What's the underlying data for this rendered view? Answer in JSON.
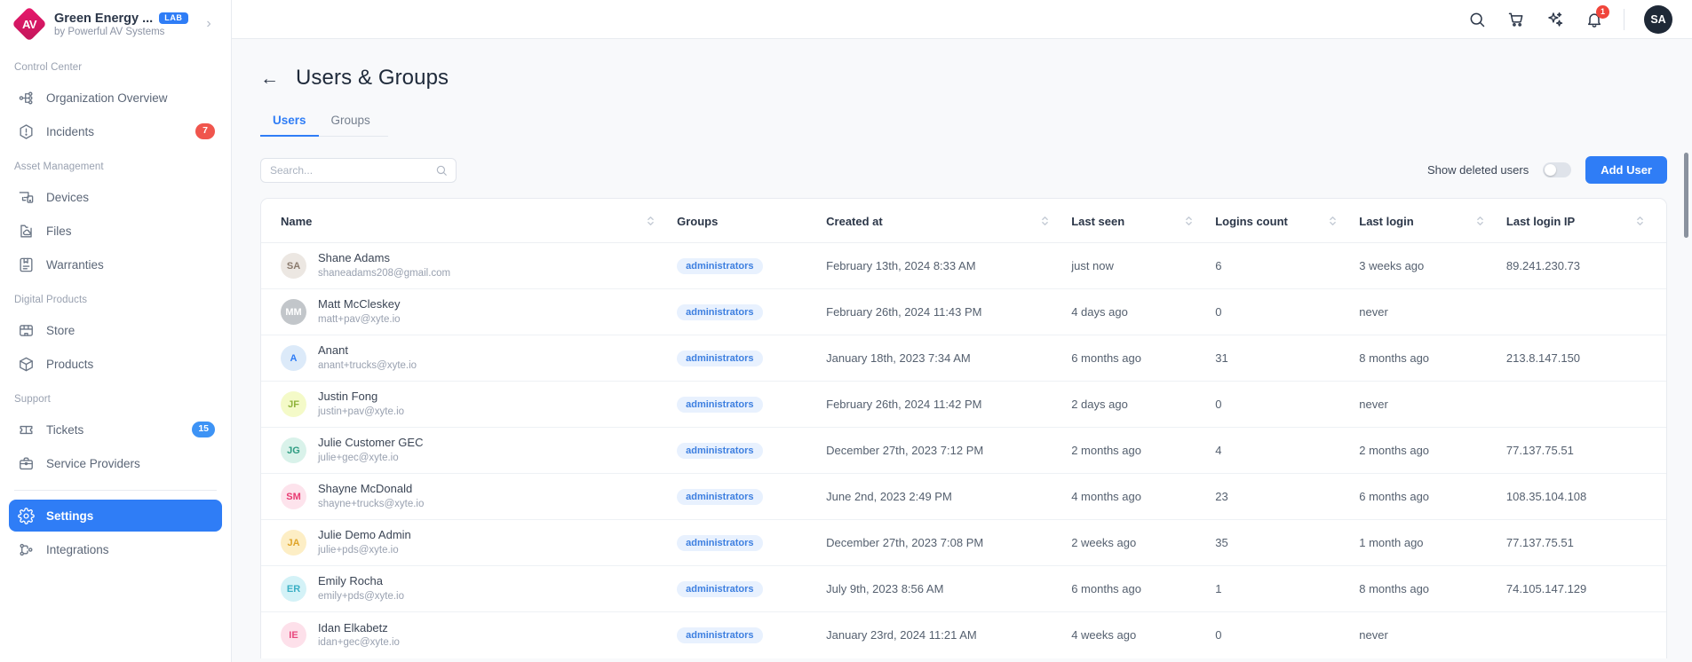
{
  "sidebar": {
    "brand": {
      "name": "Green Energy ...",
      "badge": "LAB",
      "subtitle": "by Powerful AV Systems",
      "logo_text": "AV",
      "chevron": "›"
    },
    "sections": [
      {
        "label": "Control Center",
        "items": [
          {
            "label": "Organization Overview",
            "icon": "org-chart-icon",
            "badge": null
          },
          {
            "label": "Incidents",
            "icon": "alert-hexagon-icon",
            "badge": "7",
            "badge_color": "red"
          }
        ]
      },
      {
        "label": "Asset Management",
        "items": [
          {
            "label": "Devices",
            "icon": "devices-icon",
            "badge": null
          },
          {
            "label": "Files",
            "icon": "folder-cloud-icon",
            "badge": null
          },
          {
            "label": "Warranties",
            "icon": "document-badge-icon",
            "badge": null
          }
        ]
      },
      {
        "label": "Digital Products",
        "items": [
          {
            "label": "Store",
            "icon": "store-icon",
            "badge": null
          },
          {
            "label": "Products",
            "icon": "box-icon",
            "badge": null
          }
        ]
      },
      {
        "label": "Support",
        "items": [
          {
            "label": "Tickets",
            "icon": "ticket-icon",
            "badge": "15",
            "badge_color": "blue"
          },
          {
            "label": "Service Providers",
            "icon": "briefcase-icon",
            "badge": null
          }
        ]
      }
    ],
    "footer_items": [
      {
        "label": "Settings",
        "icon": "gear-icon",
        "active": true
      },
      {
        "label": "Integrations",
        "icon": "integrations-icon",
        "active": false
      }
    ]
  },
  "topbar": {
    "icons": [
      "search-icon",
      "cart-icon",
      "sparkles-icon",
      "bell-icon"
    ],
    "notification_count": "1",
    "avatar_initials": "SA"
  },
  "page": {
    "back_arrow": "←",
    "title": "Users & Groups",
    "tabs": [
      {
        "label": "Users",
        "active": true
      },
      {
        "label": "Groups",
        "active": false
      }
    ]
  },
  "toolbar": {
    "search_placeholder": "Search...",
    "search_value": "",
    "show_deleted_label": "Show deleted users",
    "show_deleted_on": false,
    "add_user_label": "Add User"
  },
  "table": {
    "columns": [
      {
        "key": "name",
        "label": "Name",
        "sortable": true
      },
      {
        "key": "groups",
        "label": "Groups",
        "sortable": false
      },
      {
        "key": "created",
        "label": "Created at",
        "sortable": true
      },
      {
        "key": "seen",
        "label": "Last seen",
        "sortable": true
      },
      {
        "key": "logins",
        "label": "Logins count",
        "sortable": true
      },
      {
        "key": "login",
        "label": "Last login",
        "sortable": true
      },
      {
        "key": "ip",
        "label": "Last login IP",
        "sortable": true
      }
    ],
    "rows": [
      {
        "initials": "SA",
        "avatar_bg": "#ece7e2",
        "avatar_fg": "#8a7a6d",
        "name": "Shane Adams",
        "email": "shaneadams208@gmail.com",
        "group": "administrators",
        "created": "February 13th, 2024 8:33 AM",
        "seen": "just now",
        "logins": "6",
        "login": "3 weeks ago",
        "ip": "89.241.230.73"
      },
      {
        "initials": "MM",
        "avatar_bg": "#c2c6ca",
        "avatar_fg": "#ffffff",
        "name": "Matt McCleskey",
        "email": "matt+pav@xyte.io",
        "group": "administrators",
        "created": "February 26th, 2024 11:43 PM",
        "seen": "4 days ago",
        "logins": "0",
        "login": "never",
        "ip": ""
      },
      {
        "initials": "A",
        "avatar_bg": "#dceaf9",
        "avatar_fg": "#2f7df6",
        "name": "Anant",
        "email": "anant+trucks@xyte.io",
        "group": "administrators",
        "created": "January 18th, 2023 7:34 AM",
        "seen": "6 months ago",
        "logins": "31",
        "login": "8 months ago",
        "ip": "213.8.147.150"
      },
      {
        "initials": "JF",
        "avatar_bg": "#f4fac8",
        "avatar_fg": "#8fb33a",
        "name": "Justin Fong",
        "email": "justin+pav@xyte.io",
        "group": "administrators",
        "created": "February 26th, 2024 11:42 PM",
        "seen": "2 days ago",
        "logins": "0",
        "login": "never",
        "ip": ""
      },
      {
        "initials": "JG",
        "avatar_bg": "#d9f2ea",
        "avatar_fg": "#2e9c82",
        "name": "Julie Customer GEC",
        "email": "julie+gec@xyte.io",
        "group": "administrators",
        "created": "December 27th, 2023 7:12 PM",
        "seen": "2 months ago",
        "logins": "4",
        "login": "2 months ago",
        "ip": "77.137.75.51"
      },
      {
        "initials": "SM",
        "avatar_bg": "#fde3ec",
        "avatar_fg": "#e83a72",
        "name": "Shayne McDonald",
        "email": "shayne+trucks@xyte.io",
        "group": "administrators",
        "created": "June 2nd, 2023 2:49 PM",
        "seen": "4 months ago",
        "logins": "23",
        "login": "6 months ago",
        "ip": "108.35.104.108"
      },
      {
        "initials": "JA",
        "avatar_bg": "#fdeec5",
        "avatar_fg": "#e0a52a",
        "name": "Julie Demo Admin",
        "email": "julie+pds@xyte.io",
        "group": "administrators",
        "created": "December 27th, 2023 7:08 PM",
        "seen": "2 weeks ago",
        "logins": "35",
        "login": "1 month ago",
        "ip": "77.137.75.51"
      },
      {
        "initials": "ER",
        "avatar_bg": "#d4f2f7",
        "avatar_fg": "#3aafc4",
        "name": "Emily Rocha",
        "email": "emily+pds@xyte.io",
        "group": "administrators",
        "created": "July 9th, 2023 8:56 AM",
        "seen": "6 months ago",
        "logins": "1",
        "login": "8 months ago",
        "ip": "74.105.147.129"
      },
      {
        "initials": "IE",
        "avatar_bg": "#fde0ea",
        "avatar_fg": "#e8487e",
        "name": "Idan Elkabetz",
        "email": "idan+gec@xyte.io",
        "group": "administrators",
        "created": "January 23rd, 2024 11:21 AM",
        "seen": "4 weeks ago",
        "logins": "0",
        "login": "never",
        "ip": ""
      }
    ]
  },
  "colors": {
    "accent": "#2f7df6",
    "chip_bg": "#e8f1fe",
    "chip_fg": "#3d7fe0",
    "danger": "#f0554d"
  }
}
